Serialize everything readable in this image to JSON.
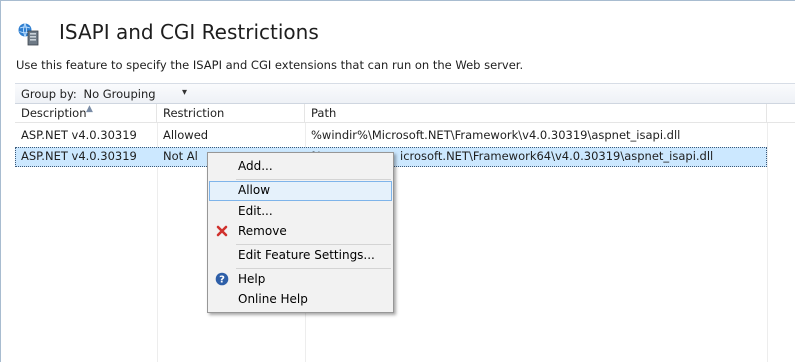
{
  "header": {
    "title": "ISAPI and CGI Restrictions",
    "description": "Use this feature to specify the ISAPI and CGI extensions that can run on the Web server."
  },
  "toolbar": {
    "group_by_label": "Group by:",
    "group_by_value": "No Grouping"
  },
  "table": {
    "columns": [
      "Description",
      "Restriction",
      "Path"
    ],
    "rows": [
      {
        "description": "ASP.NET v4.0.30319",
        "restriction": "Allowed",
        "path": "%windir%\\Microsoft.NET\\Framework\\v4.0.30319\\aspnet_isapi.dll"
      },
      {
        "description": "ASP.NET v4.0.30319",
        "restriction": "Not Al",
        "path_left": "%",
        "path_right": "icrosoft.NET\\Framework64\\v4.0.30319\\aspnet_isapi.dll"
      }
    ]
  },
  "context_menu": {
    "items": [
      "Add...",
      "Allow",
      "Edit...",
      "Remove",
      "Edit Feature Settings...",
      "Help",
      "Online Help"
    ],
    "hovered": "Allow"
  },
  "colors": {
    "selection": "#cce8ff",
    "menu_hover": "#e5f1fb",
    "menu_hover_border": "#7eb4ea",
    "remove_icon": "#d0312d",
    "help_icon": "#2e5fa8"
  }
}
